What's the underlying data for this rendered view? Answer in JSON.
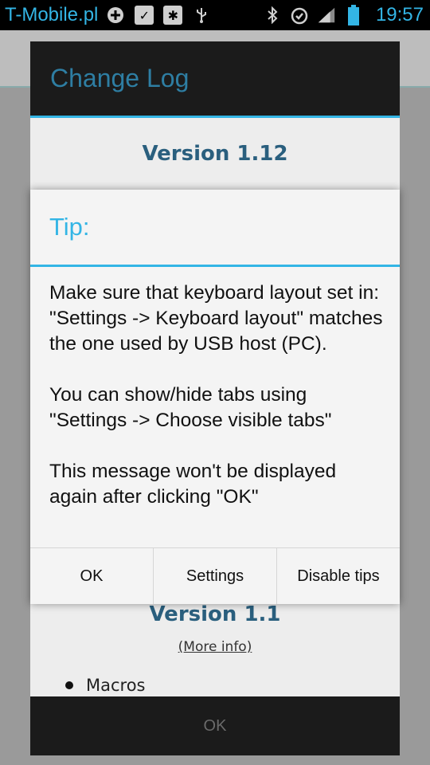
{
  "status_bar": {
    "carrier": "T-Mobile.pl",
    "time": "19:57",
    "icons": [
      "plus-circle-icon",
      "checkbox-icon",
      "bug-icon",
      "usb-icon",
      "bluetooth-icon",
      "alarm-icon",
      "signal-icon",
      "battery-icon"
    ]
  },
  "change_log": {
    "title": "Change Log",
    "version_top": "Version 1.12",
    "version_bottom": "Version 1.1",
    "more_info": "(More info)",
    "bullet_item": "Macros",
    "ok_label": "OK"
  },
  "tip": {
    "title": "Tip:",
    "paragraphs": [
      "Make sure that keyboard layout set in: \"Settings -> Keyboard layout\" matches the one used by USB host (PC).",
      "You can show/hide tabs using \"Settings -> Choose visible tabs\"",
      "This message won't be displayed again after clicking \"OK\""
    ],
    "buttons": {
      "ok": "OK",
      "settings": "Settings",
      "disable": "Disable tips"
    }
  },
  "colors": {
    "accent": "#33b5e5",
    "dialog_bg": "#f4f4f4",
    "title_bar": "#1b1b1b"
  }
}
